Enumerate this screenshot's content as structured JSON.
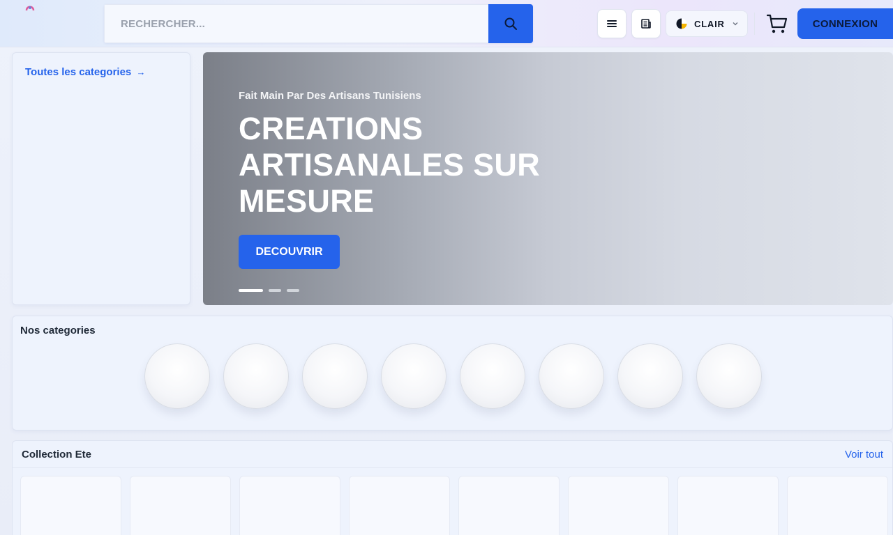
{
  "header": {
    "search": {
      "placeholder": "RECHERCHER...",
      "value": ""
    },
    "theme": {
      "label": "CLAIR"
    },
    "login_label": "CONNEXION"
  },
  "sidebar": {
    "all_categories_label": "Toutes les categories",
    "arrow": "→"
  },
  "hero": {
    "subtitle": "Fait Main Par Des Artisans Tunisiens",
    "title": "CREATIONS ARTISANALES SUR MESURE",
    "cta_label": "DECOUVRIR",
    "slides_count": 3,
    "active_slide": 1
  },
  "categories": {
    "title": "Nos categories",
    "items": [
      {},
      {},
      {},
      {},
      {},
      {},
      {},
      {}
    ]
  },
  "collection": {
    "title": "Collection Ete",
    "see_all_label": "Voir tout",
    "products": [
      {},
      {},
      {},
      {},
      {},
      {},
      {},
      {}
    ]
  },
  "colors": {
    "accent": "#2563eb",
    "background": "#eef3fd"
  },
  "icons": {
    "search": "search-icon",
    "menu": "menu-icon",
    "news": "newspaper-icon",
    "theme": "theme-icon",
    "chevron": "chevron-down-icon",
    "cart": "cart-icon"
  }
}
